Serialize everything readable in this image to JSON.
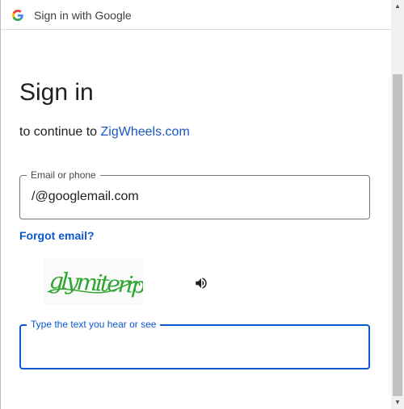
{
  "window": {
    "title": "Sign in with Google"
  },
  "signin": {
    "heading": "Sign in",
    "subtitle_prefix": "to continue to ",
    "subtitle_link": "ZigWheels.com"
  },
  "email_field": {
    "label": "Email or phone",
    "value": "/@googlemail.com"
  },
  "forgot_email": "Forgot email?",
  "captcha": {
    "image_text": "glymiterip",
    "audio_icon": "volume-icon",
    "input_label": "Type the text you hear or see",
    "input_value": ""
  },
  "colors": {
    "accent": "#0b57d0",
    "link": "#1a57c2",
    "captcha_text": "#2ea52e"
  }
}
